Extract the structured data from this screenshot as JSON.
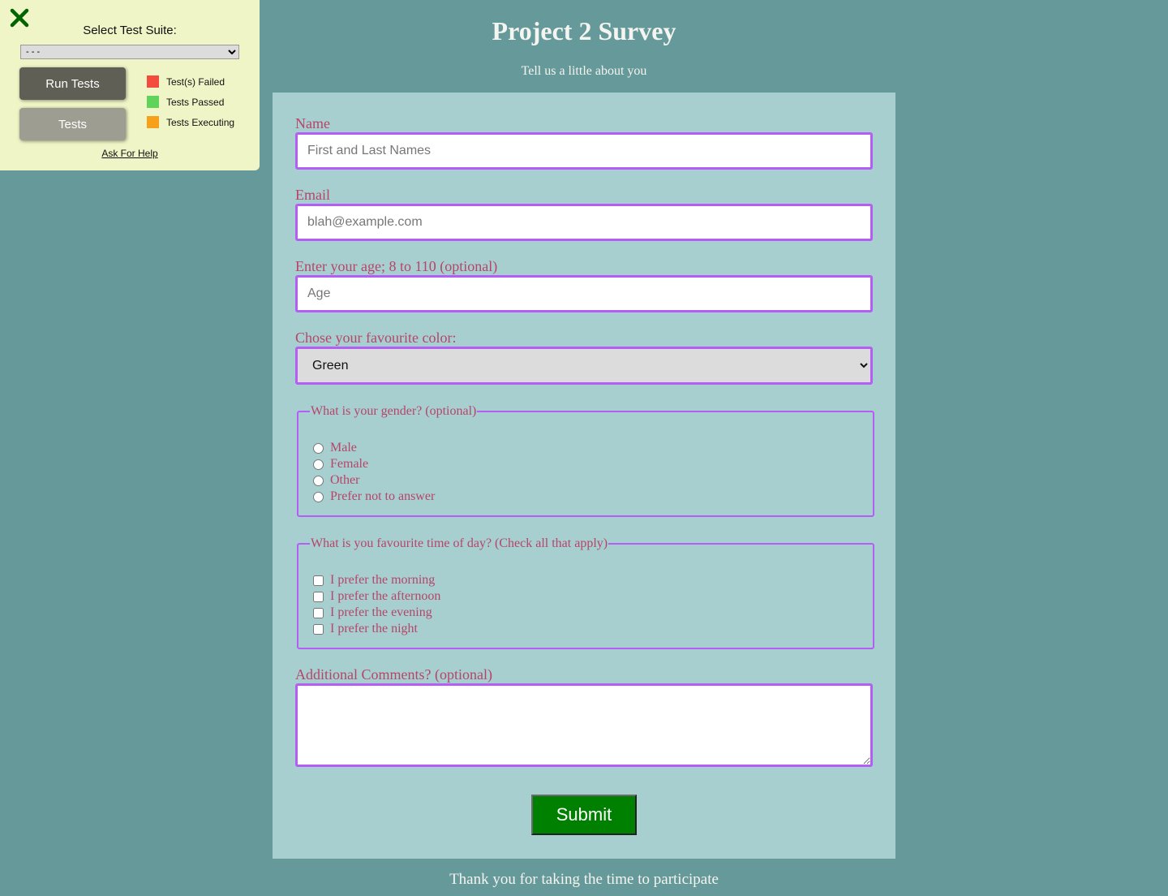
{
  "test_panel": {
    "close_icon": "close-x-icon",
    "suite_label": "Select Test Suite:",
    "suite_selected": "- - -",
    "run_tests_label": "Run Tests",
    "tests_label": "Tests",
    "legend": [
      {
        "label": "Test(s) Failed",
        "color": "#f44b3f"
      },
      {
        "label": "Tests Passed",
        "color": "#5fd35a"
      },
      {
        "label": "Tests Executing",
        "color": "#f7a11a"
      }
    ],
    "help_link": "Ask For Help",
    "close_color": "#006400"
  },
  "survey": {
    "title": "Project 2 Survey",
    "description": "Tell us a little about you",
    "name_label": "Name",
    "name_placeholder": "First and Last Names",
    "email_label": "Email",
    "email_placeholder": "blah@example.com",
    "age_label": "Enter your age; 8 to 110 (optional)",
    "age_placeholder": "Age",
    "color_label": "Chose your favourite color:",
    "color_selected": "Green",
    "gender_legend": "What is your gender? (optional)",
    "gender_options": [
      "Male",
      "Female",
      "Other",
      "Prefer not to answer"
    ],
    "time_legend": "What is you favourite time of day? (Check all that apply)",
    "time_options": [
      "I prefer the morning",
      "I prefer the afternoon",
      "I prefer the evening",
      "I prefer the night"
    ],
    "comments_label": "Additional Comments? (optional)",
    "comments_value": "",
    "submit_label": "Submit",
    "footer": "Thank you for taking the time to participate"
  }
}
